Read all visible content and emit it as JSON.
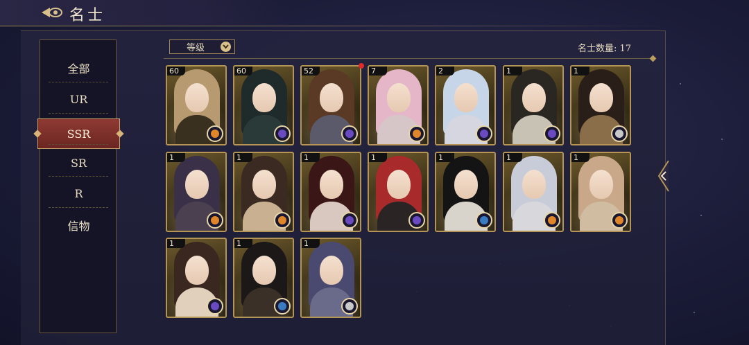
{
  "header": {
    "title": "名士"
  },
  "sidebar": {
    "items": [
      {
        "label": "全部",
        "active": false
      },
      {
        "label": "UR",
        "active": false
      },
      {
        "label": "SSR",
        "active": true
      },
      {
        "label": "SR",
        "active": false
      },
      {
        "label": "R",
        "active": false
      },
      {
        "label": "信物",
        "active": false
      }
    ]
  },
  "sort": {
    "label": "等级"
  },
  "count": {
    "text": "名士数量: 17"
  },
  "colors": {
    "gold": "#b59556",
    "active_tab": "#8e3a32",
    "element_fire": "#e0862a",
    "element_shadow": "#6a4ac0",
    "element_wind": "#3a7ac0",
    "element_earth": "#c8c8c8"
  },
  "cards": [
    {
      "level": "60",
      "hair": "#b89a70",
      "body": "#3a3020",
      "element": "element_fire"
    },
    {
      "level": "60",
      "hair": "#1f2a2a",
      "body": "#2a3a38",
      "element": "element_shadow"
    },
    {
      "level": "52",
      "hair": "#5a3a24",
      "body": "#5a5a6a",
      "element": "element_shadow",
      "new": true
    },
    {
      "level": "7",
      "hair": "#e4b6c8",
      "body": "#d6c6c8",
      "element": "element_fire"
    },
    {
      "level": "2",
      "hair": "#c6d6e8",
      "body": "#d6d6e0",
      "element": "element_shadow"
    },
    {
      "level": "1",
      "hair": "#2a2622",
      "body": "#c8c2b4",
      "element": "element_shadow"
    },
    {
      "level": "1",
      "hair": "#2a1e18",
      "body": "#8a6e4a",
      "element": "element_earth"
    },
    {
      "level": "1",
      "hair": "#3a3048",
      "body": "#4a4050",
      "element": "element_fire"
    },
    {
      "level": "1",
      "hair": "#3a2a22",
      "body": "#c8b090",
      "element": "element_fire"
    },
    {
      "level": "1",
      "hair": "#3a1616",
      "body": "#d8c8c0",
      "element": "element_shadow"
    },
    {
      "level": "1",
      "hair": "#a82a2a",
      "body": "#2a2424",
      "element": "element_shadow"
    },
    {
      "level": "1",
      "hair": "#141414",
      "body": "#d8d4cc",
      "element": "element_wind"
    },
    {
      "level": "1",
      "hair": "#c8ccd8",
      "body": "#d8d8dc",
      "element": "element_fire"
    },
    {
      "level": "1",
      "hair": "#c8a888",
      "body": "#d0bca0",
      "element": "element_fire"
    },
    {
      "level": "1",
      "hair": "#3a2820",
      "body": "#e0d0bc",
      "element": "element_shadow"
    },
    {
      "level": "1",
      "hair": "#1c1818",
      "body": "#3a3028",
      "element": "element_wind"
    },
    {
      "level": "1",
      "hair": "#4a4a70",
      "body": "#6a6a8a",
      "element": "element_earth"
    }
  ]
}
